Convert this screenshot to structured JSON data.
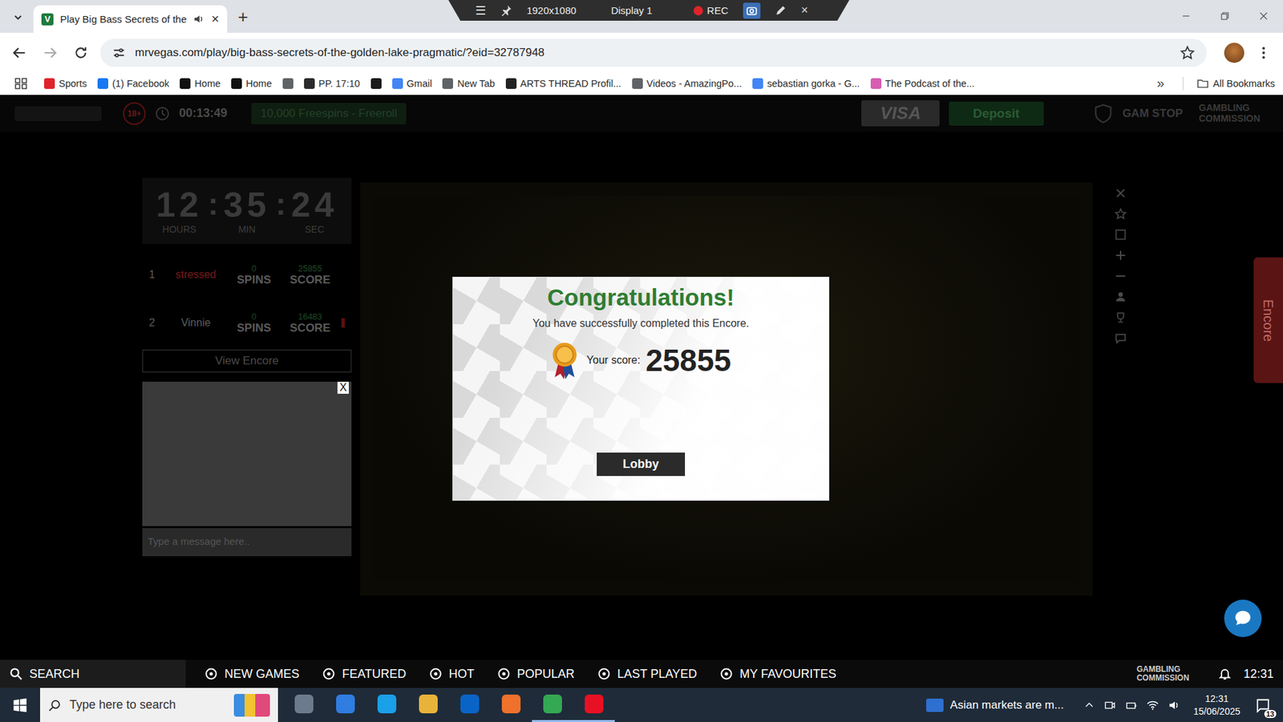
{
  "recorder": {
    "menu": "☰",
    "resolution": "1920x1080",
    "display": "Display 1",
    "rec": "REC",
    "close": "×"
  },
  "browser": {
    "tabs": [
      {
        "favicon": "V",
        "title": "Play Big Bass Secrets of the",
        "close": "×",
        "selected": true
      }
    ],
    "new_tab": "+",
    "url": "mrvegas.com/play/big-bass-secrets-of-the-golden-lake-pragmatic/?eid=32787948",
    "bookmarks": [
      {
        "label": "Sports",
        "color": "#e0242b"
      },
      {
        "label": "(1) Facebook",
        "color": "#1877f2"
      },
      {
        "label": "Home",
        "color": "#111111"
      },
      {
        "label": "Home",
        "color": "#111111"
      },
      {
        "label": "",
        "color": "#5f6368"
      },
      {
        "label": "PP. 17:10",
        "color": "#2b2b2b"
      },
      {
        "label": "",
        "color": "#1a1a1a"
      },
      {
        "label": "Gmail",
        "color": "#4285f4"
      },
      {
        "label": "New Tab",
        "color": "#5f6368"
      },
      {
        "label": "ARTS THREAD Profil...",
        "color": "#222222"
      },
      {
        "label": "Videos - AmazingPo...",
        "color": "#5f6368"
      },
      {
        "label": "sebastian gorka - G...",
        "color": "#4285f4"
      },
      {
        "label": "The Podcast of the...",
        "color": "#d65db1"
      }
    ],
    "more": "»",
    "all_bookmarks": "All Bookmarks"
  },
  "site_header": {
    "age": "18+",
    "clock": "00:13:49",
    "promo": "10,000 Freespins - Freeroll",
    "visa": "VISA",
    "deposit": "Deposit",
    "gamstop": "GAM STOP",
    "commission": "GAMBLING COMMISSION"
  },
  "encore": {
    "countdown": [
      {
        "value": "12",
        "unit": "HOURS"
      },
      {
        "value": "35",
        "unit": "MIN"
      },
      {
        "value": "24",
        "unit": "SEC"
      }
    ],
    "separator": ":",
    "leaderboard": [
      {
        "rank": "1",
        "name": "stressed",
        "spins": "0",
        "spins_label": "SPINS",
        "score": "25855",
        "score_label": "SCORE",
        "selected": true
      },
      {
        "rank": "2",
        "name": "Vinnie",
        "spins": "0",
        "spins_label": "SPINS",
        "score": "16483",
        "score_label": "SCORE",
        "selected": false
      }
    ],
    "view_button": "View Encore",
    "chat": {
      "close": "X",
      "placeholder": "Type a message here.."
    },
    "side_tab": "Encore"
  },
  "modal": {
    "title": "Congratulations!",
    "message": "You have successfully completed this Encore.",
    "score_label": "Your score:",
    "score": "25855",
    "button": "Lobby"
  },
  "bottom_nav": {
    "search": "SEARCH",
    "items": [
      "NEW GAMES",
      "FEATURED",
      "HOT",
      "POPULAR",
      "LAST PLAYED",
      "MY FAVOURITES"
    ],
    "commission": "GAMBLING COMMISSION",
    "time": "12:31"
  },
  "taskbar": {
    "search_placeholder": "Type here to search",
    "apps": [
      {
        "color": "#6b7a8c",
        "selected": false
      },
      {
        "color": "#2f7de1",
        "selected": false
      },
      {
        "color": "#1aa0e8",
        "selected": false
      },
      {
        "color": "#e8b33a",
        "selected": false
      },
      {
        "color": "#0a64c8",
        "selected": false
      },
      {
        "color": "#f0712c",
        "selected": false
      },
      {
        "color": "#34a853",
        "selected": true
      },
      {
        "color": "#e81123",
        "selected": true
      }
    ],
    "news": "Asian markets are m...",
    "time": "12:31",
    "date": "15/06/2025",
    "notifications": "13"
  }
}
